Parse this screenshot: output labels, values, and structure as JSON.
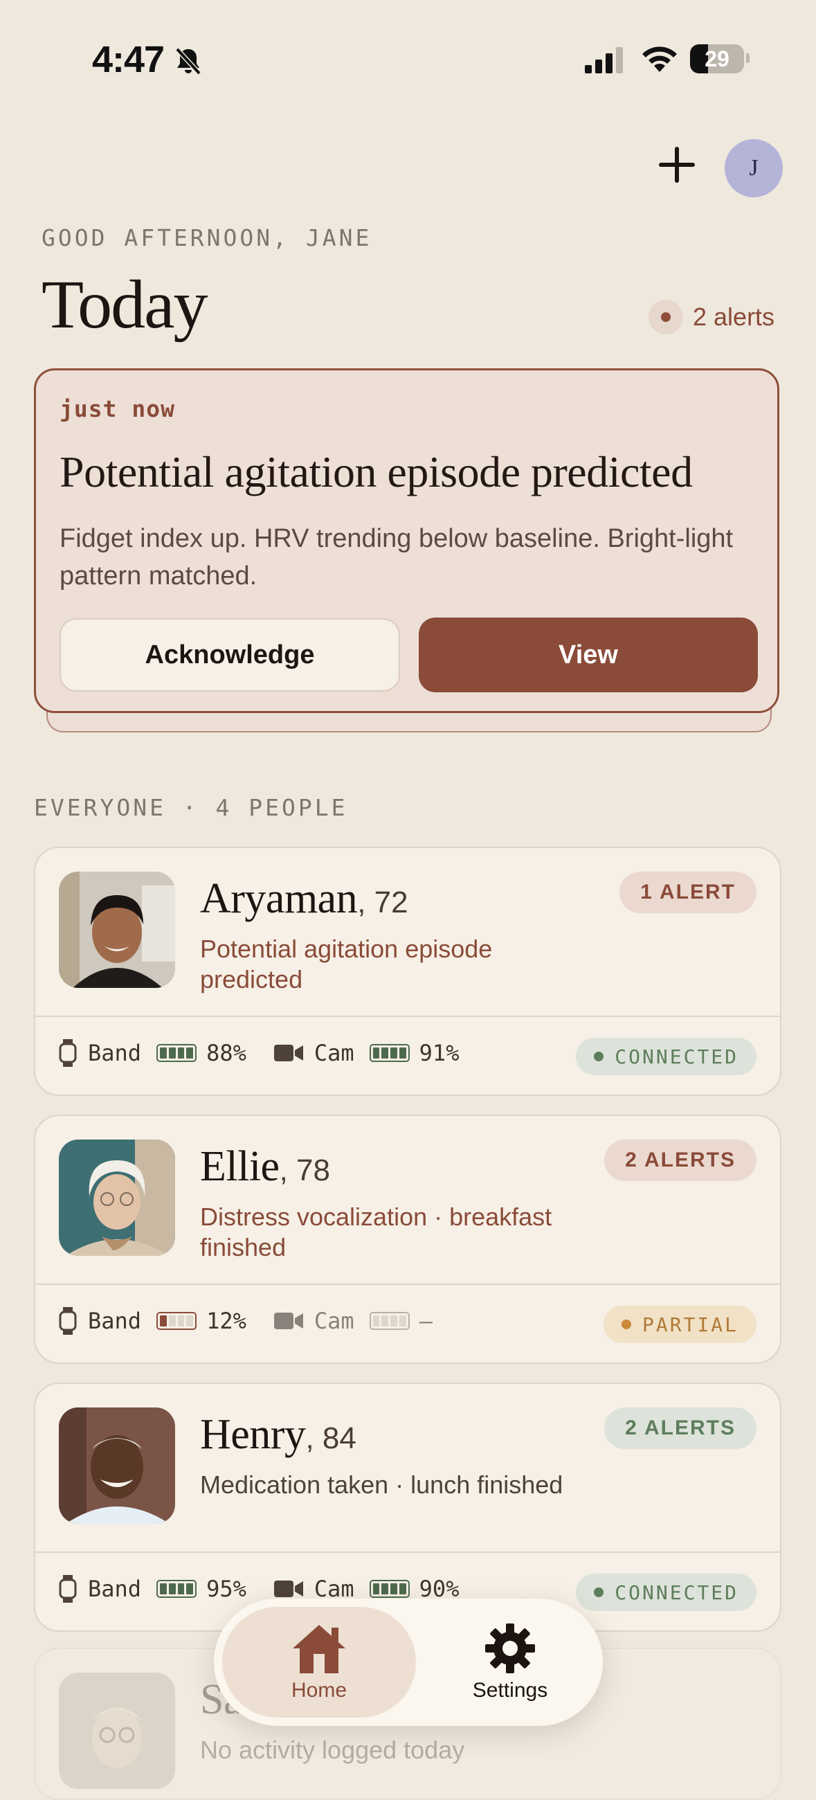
{
  "status_bar": {
    "time": "4:47",
    "battery": "29"
  },
  "header": {
    "avatar_initial": "J"
  },
  "greeting": "GOOD AFTERNOON, JANE",
  "title": "Today",
  "alerts_count": "2 alerts",
  "alert": {
    "time": "just now",
    "title": "Potential agitation episode predicted",
    "body": "Fidget index up. HRV trending below baseline. Bright-light pattern matched.",
    "acknowledge_label": "Acknowledge",
    "view_label": "View"
  },
  "section_label": "EVERYONE · 4 PEOPLE",
  "people": [
    {
      "name": "Aryaman",
      "age": ", 72",
      "status": "Potential agitation episode predicted",
      "badge": "1 ALERT",
      "band_label": "Band",
      "band_battery": "88%",
      "band_level": 0.88,
      "cam_label": "Cam",
      "cam_battery": "91%",
      "cam_level": 0.91,
      "connection": "CONNECTED"
    },
    {
      "name": "Ellie",
      "age": ", 78",
      "status": "Distress vocalization · breakfast finished",
      "badge": "2 ALERTS",
      "band_label": "Band",
      "band_battery": "12%",
      "band_level": 0.12,
      "cam_label": "Cam",
      "cam_battery": "—",
      "connection": "PARTIAL"
    },
    {
      "name": "Henry",
      "age": ", 84",
      "status": "Medication taken · lunch finished",
      "badge": "2 ALERTS",
      "band_label": "Band",
      "band_battery": "95%",
      "band_level": 0.95,
      "cam_label": "Cam",
      "cam_battery": "90%",
      "cam_level": 0.9,
      "connection": "CONNECTED"
    },
    {
      "name": "Sa",
      "status": "No activity logged today"
    }
  ],
  "nav": {
    "home_label": "Home",
    "settings_label": "Settings"
  },
  "colors": {
    "accent": "#8A4B39",
    "background": "#EEE8DD",
    "card": "#F6F0E6",
    "connected": "#5E7D5C",
    "partial": "#C98A3A"
  }
}
